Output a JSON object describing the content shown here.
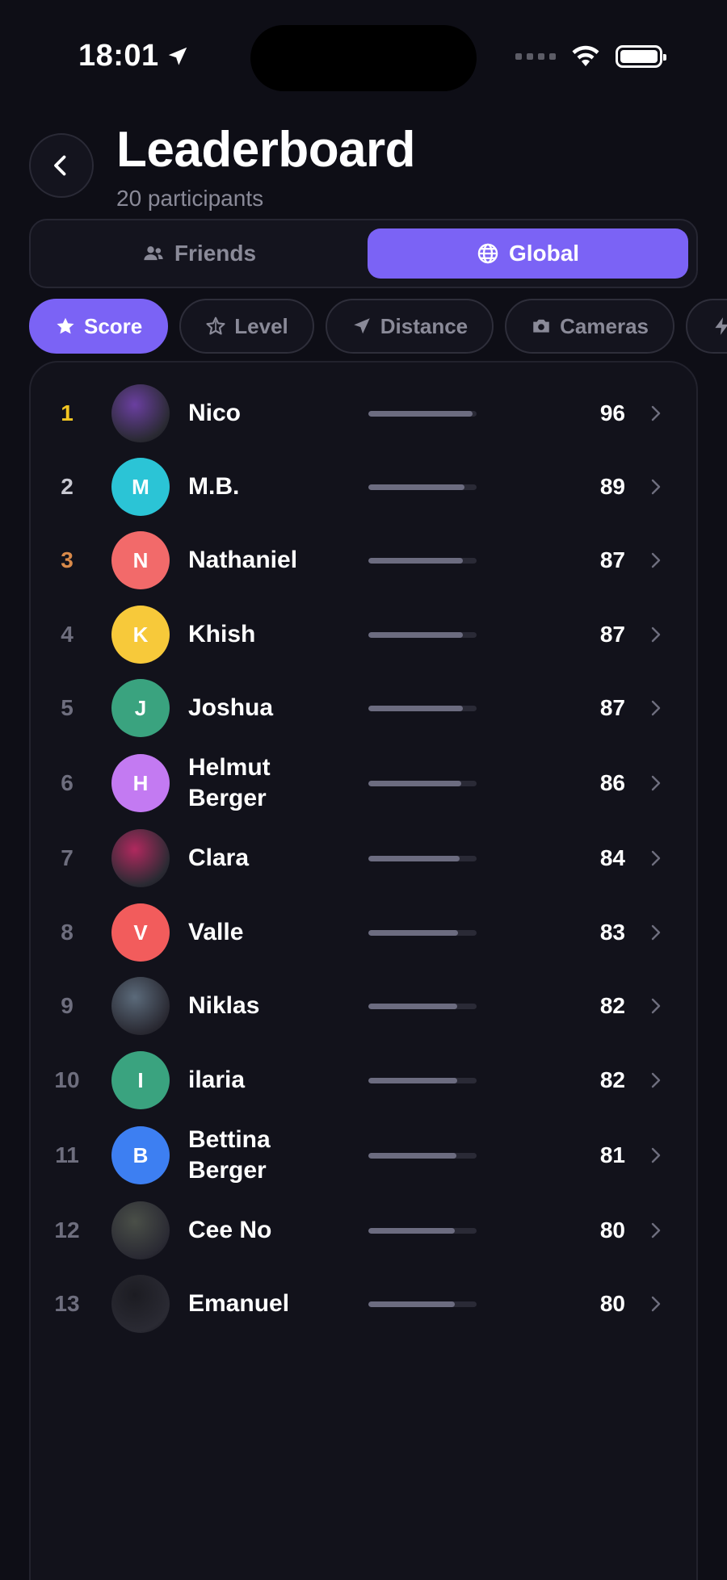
{
  "status_bar": {
    "time": "18:01"
  },
  "header": {
    "title": "Leaderboard",
    "subtitle": "20 participants"
  },
  "segments": [
    {
      "label": "Friends",
      "icon": "people-icon",
      "active": false
    },
    {
      "label": "Global",
      "icon": "globe-icon",
      "active": true
    }
  ],
  "filters": [
    {
      "label": "Score",
      "icon": "star-icon",
      "active": true
    },
    {
      "label": "Level",
      "icon": "sparkle-star-icon",
      "active": false
    },
    {
      "label": "Distance",
      "icon": "location-arrow-icon",
      "active": false
    },
    {
      "label": "Cameras",
      "icon": "camera-icon",
      "active": false
    },
    {
      "label": "",
      "icon": "bolt-icon",
      "active": false
    }
  ],
  "colors": {
    "accent": "#7b63f5",
    "background": "#0e0e16",
    "card": "#12121b",
    "rank_gold": "#f3c623",
    "rank_bronze": "#d98a4a",
    "rank_default": "#6e6e7e",
    "bar_fill": "#6c6c80"
  },
  "leaderboard": [
    {
      "rank": "1",
      "name": "Nico",
      "initial": "",
      "avatar": "photo",
      "avatar_color": "#6a3fa0",
      "score": "96",
      "bar_fraction": 0.96
    },
    {
      "rank": "2",
      "name": "M.B.",
      "initial": "M",
      "avatar": "initial",
      "avatar_color": "#2bc4d6",
      "score": "89",
      "bar_fraction": 0.89
    },
    {
      "rank": "3",
      "name": "Nathaniel",
      "initial": "N",
      "avatar": "initial",
      "avatar_color": "#f26a6a",
      "score": "87",
      "bar_fraction": 0.87
    },
    {
      "rank": "4",
      "name": "Khish",
      "initial": "K",
      "avatar": "initial",
      "avatar_color": "#f7c93a",
      "score": "87",
      "bar_fraction": 0.87
    },
    {
      "rank": "5",
      "name": "Joshua",
      "initial": "J",
      "avatar": "initial",
      "avatar_color": "#3aa37f",
      "score": "87",
      "bar_fraction": 0.87
    },
    {
      "rank": "6",
      "name": "Helmut Berger",
      "initial": "H",
      "avatar": "initial",
      "avatar_color": "#c37af2",
      "score": "86",
      "bar_fraction": 0.86
    },
    {
      "rank": "7",
      "name": "Clara",
      "initial": "",
      "avatar": "photo",
      "avatar_color": "#b0295e",
      "score": "84",
      "bar_fraction": 0.84
    },
    {
      "rank": "8",
      "name": "Valle",
      "initial": "V",
      "avatar": "initial",
      "avatar_color": "#f25c5c",
      "score": "83",
      "bar_fraction": 0.83
    },
    {
      "rank": "9",
      "name": "Niklas",
      "initial": "",
      "avatar": "photo",
      "avatar_color": "#5b6a7a",
      "score": "82",
      "bar_fraction": 0.82
    },
    {
      "rank": "10",
      "name": "ilaria",
      "initial": "I",
      "avatar": "initial",
      "avatar_color": "#3aa37f",
      "score": "82",
      "bar_fraction": 0.82
    },
    {
      "rank": "11",
      "name": "Bettina Berger",
      "initial": "B",
      "avatar": "initial",
      "avatar_color": "#3d7ff2",
      "score": "81",
      "bar_fraction": 0.81
    },
    {
      "rank": "12",
      "name": "Cee No",
      "initial": "",
      "avatar": "photo",
      "avatar_color": "#4a4f48",
      "score": "80",
      "bar_fraction": 0.8
    },
    {
      "rank": "13",
      "name": "Emanuel",
      "initial": "",
      "avatar": "photo",
      "avatar_color": "#1c1c22",
      "score": "80",
      "bar_fraction": 0.8
    }
  ]
}
